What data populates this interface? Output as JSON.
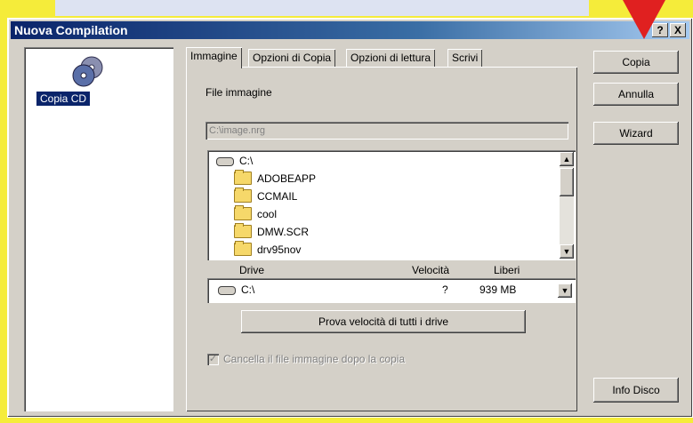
{
  "window": {
    "title": "Nuova Compilation",
    "help_btn": "?",
    "close_btn": "X"
  },
  "left_pane": {
    "item_label": "Copia CD",
    "item_icon": "cd-copy-icon"
  },
  "tabs": [
    "Immagine",
    "Opzioni di Copia",
    "Opzioni di lettura",
    "Scrivi"
  ],
  "image_tab": {
    "file_label": "File immagine",
    "file_value": "C:\\image.nrg",
    "tree_root": "C:\\",
    "folders": [
      "ADOBEAPP",
      "CCMAIL",
      "cool",
      "DMW.SCR",
      "drv95nov"
    ],
    "drive_headers": {
      "drive": "Drive",
      "speed": "Velocità",
      "free": "Liberi"
    },
    "drive_row": {
      "drive": "C:\\",
      "speed": "?",
      "free": "939 MB"
    },
    "test_button": "Prova velocità di tutti i drive",
    "delete_checkbox": "Cancella il file immagine dopo la copia",
    "delete_checked": true
  },
  "buttons": {
    "copy": "Copia",
    "cancel": "Annulla",
    "wizard": "Wizard",
    "info": "Info Disco"
  },
  "colors": {
    "accent_arrow": "#e02020",
    "title_bar": "#0a246a",
    "background": "#f5ec3a"
  }
}
